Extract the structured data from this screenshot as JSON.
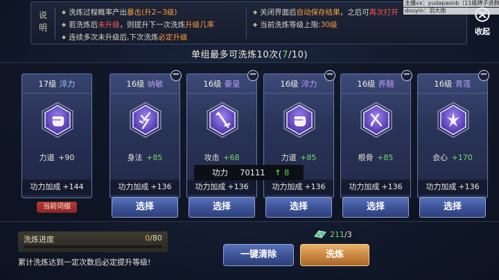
{
  "info": {
    "title": "说明",
    "left_lines": [
      [
        "洗炼过程概率产出",
        "暴击(升2~3级)",
        ""
      ],
      [
        "若洗炼后",
        "未升级",
        "，则提升下一次洗炼",
        "升级几率",
        ""
      ],
      [
        "连续多次未升级后,下次洗炼",
        "必定升级",
        ""
      ]
    ],
    "right_lines": [
      [
        "关闭界面后",
        "自动保存结果",
        "，之后可",
        "再次打开",
        ""
      ],
      [
        "当前洗炼等级上限:",
        "30级",
        ""
      ]
    ]
  },
  "collapse_label": "收起",
  "overlay": [
    "主播vx：yudapaonb（11级牌子进群）",
    "douyin：羽大炮"
  ],
  "count": {
    "prefix": "单组最多可洗炼10次(",
    "current": "7",
    "suffix": "/10)"
  },
  "cards": [
    {
      "level": "17级",
      "type": "淬力",
      "stat_name": "力道",
      "stat_value": "+90",
      "power_label": "功力加成",
      "power_value": "+144",
      "current": true
    },
    {
      "level": "16级",
      "type": "纳敏",
      "stat_name": "身法",
      "stat_value": "+85",
      "power_label": "功力加成",
      "power_value": "+136",
      "select": "选择"
    },
    {
      "level": "16级",
      "type": "秦皇",
      "stat_name": "攻击",
      "stat_value": "+68",
      "power_label": "功力加成",
      "power_value": "+136",
      "select": "选择"
    },
    {
      "level": "16级",
      "type": "淬力",
      "stat_name": "力道",
      "stat_value": "+85",
      "power_label": "功力加成",
      "power_value": "+136",
      "select": "选择"
    },
    {
      "level": "16级",
      "type": "养髓",
      "stat_name": "根骨",
      "stat_value": "+85",
      "power_label": "功力加成",
      "power_value": "+136",
      "select": "选择"
    },
    {
      "level": "16级",
      "type": "青莲",
      "stat_name": "会心",
      "stat_value": "+170",
      "power_label": "功力加成",
      "power_value": "+136",
      "select": "选择"
    }
  ],
  "current_tag": "当前词缀",
  "tooltip": {
    "label": "功力",
    "value": "70111",
    "arrow": "↑",
    "delta": "8"
  },
  "progress": {
    "label": "洗炼进度",
    "current": "0",
    "total": "/80",
    "fraction": 0
  },
  "hint": "累计洗炼达到一定次数后必定提升等级!",
  "resource": {
    "have": "211",
    "need": "/3"
  },
  "buttons": {
    "clear": "一键清除",
    "refine": "洗炼"
  },
  "colors": {
    "accent_green": "#7ad86e",
    "accent_red": "#ff5555",
    "accent_orange": "#ff9c3a",
    "type_purple": "#b59af0"
  }
}
